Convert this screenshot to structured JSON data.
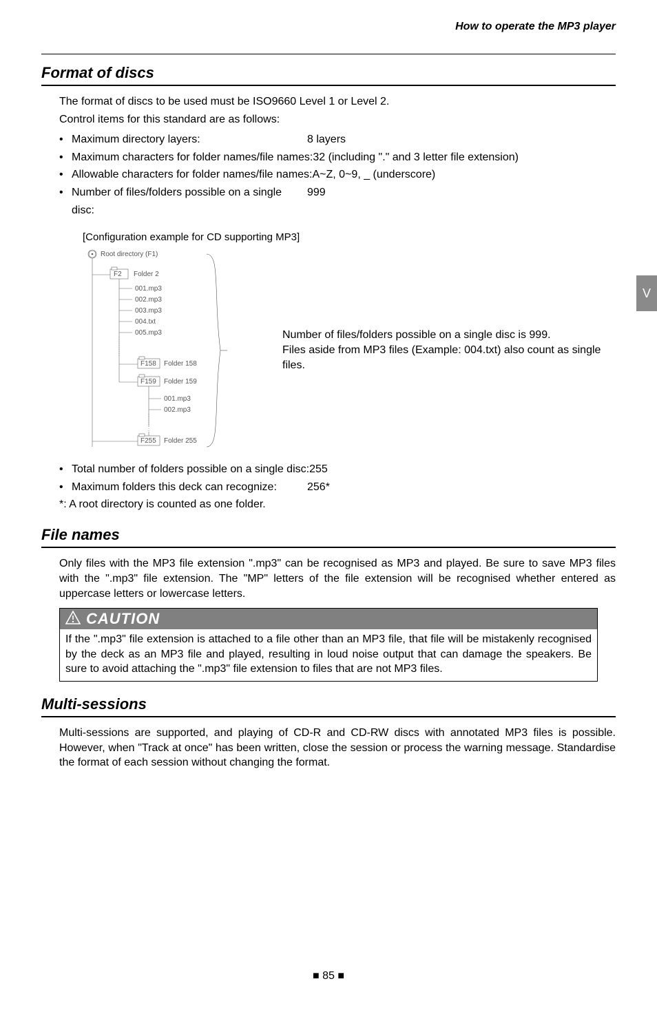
{
  "running_head": "How to operate the MP3 player",
  "side_tab": "V",
  "page_number": "85",
  "section1": {
    "title": "Format of discs",
    "intro1": "The format of discs to be used must be ISO9660 Level 1 or Level 2.",
    "intro2": "Control items for this standard are as follows:",
    "bullets_a": [
      {
        "label": "Maximum directory layers:",
        "value": "8 layers"
      },
      {
        "label": "Maximum characters for folder names/file names:",
        "value": "32 (including \".\" and 3 letter file extension)"
      },
      {
        "label": "Allowable characters for folder names/file names:",
        "value": "A~Z, 0~9, _ (underscore)"
      },
      {
        "label": "Number of files/folders possible on a single disc:",
        "value": "999"
      }
    ],
    "config_caption": "[Configuration example for CD supporting MP3]",
    "diagram": {
      "root": "Root directory (F1)",
      "f2_code": "F2",
      "f2_label": "Folder 2",
      "files_a": [
        "001.mp3",
        "002.mp3",
        "003.mp3",
        "004.txt",
        "005.mp3"
      ],
      "f158_code": "F158",
      "f158_label": "Folder 158",
      "f159_code": "F159",
      "f159_label": "Folder 159",
      "files_b": [
        "001.mp3",
        "002.mp3"
      ],
      "f255_code": "F255",
      "f255_label": "Folder 255"
    },
    "side_note1": "Number of files/folders possible on a single disc is 999.",
    "side_note2": "Files aside from MP3 files (Example: 004.txt) also count as single files.",
    "bullets_b": [
      {
        "label": "Total number of folders possible on a single disc:",
        "value": "255"
      },
      {
        "label": "Maximum folders this deck can recognize:",
        "value": "256*"
      }
    ],
    "footnote": "*: A root directory is counted as one folder."
  },
  "section2": {
    "title": "File names",
    "body": "Only files with the MP3 file extension \".mp3\" can be recognised as MP3 and played. Be sure to save MP3 files with the \".mp3\" file extension. The \"MP\" letters of the file extension will be recognised whether entered as uppercase letters or lowercase letters.",
    "caution_title": "CAUTION",
    "caution_body": "If the \".mp3\" file extension is attached to a file other than an MP3 file, that file will be mistakenly recognised by the deck as an MP3 file and played, resulting in loud noise output that can damage the speakers. Be sure to avoid attaching the \".mp3\" file extension to files that are not MP3 files."
  },
  "section3": {
    "title": "Multi-sessions",
    "body": "Multi-sessions are supported, and playing of CD-R and CD-RW discs with annotated MP3 files is possible. However, when \"Track at once\" has been written, close the session or process the warning message. Standardise the format of each session without changing the format."
  }
}
